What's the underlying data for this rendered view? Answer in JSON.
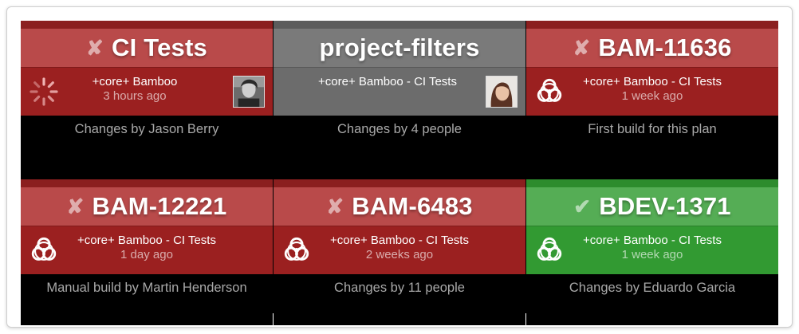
{
  "colors": {
    "failed": "#9b2020",
    "in_progress": "#6c6c6c",
    "successful": "#329a32",
    "wall_background": "#000000"
  },
  "tiles": [
    {
      "status": "failed",
      "status_icon": "cross-icon",
      "mark": "✘",
      "title": "CI Tests",
      "plan": "+core+ Bamboo",
      "time": "3 hours ago",
      "left_icon": "spinner-icon",
      "avatar": "user-avatar",
      "reason": "Changes by Jason Berry"
    },
    {
      "status": "in_progress",
      "status_icon": "",
      "mark": "",
      "title": "project-filters",
      "plan": "+core+ Bamboo - CI Tests",
      "time": "",
      "left_icon": "",
      "avatar": "user-avatar",
      "reason": "Changes by 4 people"
    },
    {
      "status": "failed",
      "status_icon": "cross-icon",
      "mark": "✘",
      "title": "BAM-11636",
      "plan": "+core+ Bamboo - CI Tests",
      "time": "1 week ago",
      "left_icon": "biohazard-icon",
      "avatar": "",
      "reason": "First build for this plan"
    },
    {
      "status": "failed",
      "status_icon": "cross-icon",
      "mark": "✘",
      "title": "BAM-12221",
      "plan": "+core+ Bamboo - CI Tests",
      "time": "1 day ago",
      "left_icon": "biohazard-icon",
      "avatar": "",
      "reason": "Manual build by Martin Henderson"
    },
    {
      "status": "failed",
      "status_icon": "cross-icon",
      "mark": "✘",
      "title": "BAM-6483",
      "plan": "+core+ Bamboo - CI Tests",
      "time": "2 weeks ago",
      "left_icon": "biohazard-icon",
      "avatar": "",
      "reason": "Changes by 11 people"
    },
    {
      "status": "successful",
      "status_icon": "check-icon",
      "mark": "✔",
      "title": "BDEV-1371",
      "plan": "+core+ Bamboo - CI Tests",
      "time": "1 week ago",
      "left_icon": "biohazard-icon",
      "avatar": "",
      "reason": "Changes by Eduardo Garcia"
    }
  ]
}
